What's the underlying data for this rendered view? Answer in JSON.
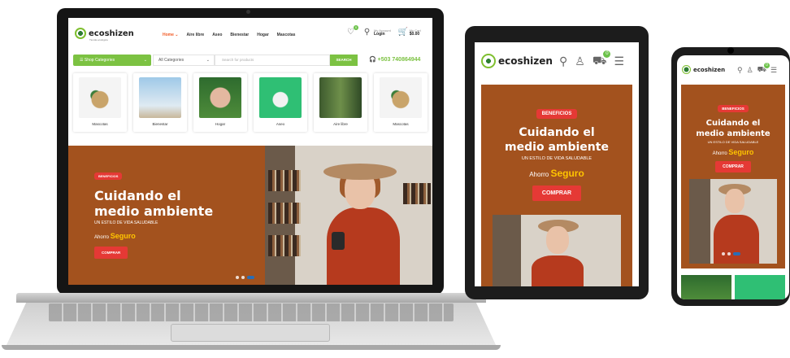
{
  "brand": {
    "name": "ecoshizen",
    "tagline": "Tienda ecológica"
  },
  "colors": {
    "accent_green": "#7cc242",
    "hero_brown": "#a3521e",
    "cta_red": "#e53935",
    "highlight_yellow": "#ffc400",
    "nav_active": "#f15a24"
  },
  "laptop": {
    "nav": [
      "Home",
      "Aire libre",
      "Aseo",
      "Bienestar",
      "Hogar",
      "Mascotas"
    ],
    "account": {
      "label": "My Account",
      "value": "Login"
    },
    "cart": {
      "label": "My Cart",
      "value": "$0.00",
      "count": "0"
    },
    "wishlist_count": "0",
    "search": {
      "shop_categories": "Shop Categories",
      "all_categories": "All Categories",
      "placeholder": "Search for products",
      "button": "SEARCH",
      "phone": "+503 740864944"
    },
    "categories": [
      {
        "name": "Mascotas"
      },
      {
        "name": "Bienestar"
      },
      {
        "name": "Hogar"
      },
      {
        "name": "Aseo"
      },
      {
        "name": "Aire libre"
      },
      {
        "name": "Mascotas"
      }
    ],
    "hero": {
      "badge": "BENEFICIOS",
      "title_line1": "Cuidando el",
      "title_line2": "medio ambiente",
      "subtitle": "UN ESTILO DE VIDA SALUDABLE",
      "save_prefix": "Ahorro",
      "save_highlight": "Seguro",
      "cta": "COMPRAR",
      "slides": 3,
      "active_slide": 3
    }
  },
  "tablet": {
    "cart_count": "0",
    "hero": {
      "badge": "BENEFICIOS",
      "title_line1": "Cuidando el",
      "title_line2": "medio ambiente",
      "subtitle": "UN ESTILO DE VIDA SALUDABLE",
      "save_prefix": "Ahorro",
      "save_highlight": "Seguro",
      "cta": "COMPRAR"
    }
  },
  "phone": {
    "cart_count": "0",
    "hero": {
      "badge": "BENEFICIOS",
      "title_line1": "Cuidando el",
      "title_line2": "medio ambiente",
      "subtitle": "UN ESTILO DE VIDA SALUDABLE",
      "save_prefix": "Ahorro",
      "save_highlight": "Seguro",
      "cta": "COMPRAR"
    }
  },
  "icons": [
    "heart-icon",
    "user-icon",
    "cart-icon",
    "search-icon",
    "menu-icon",
    "headset-icon",
    "chevron-down-icon"
  ]
}
